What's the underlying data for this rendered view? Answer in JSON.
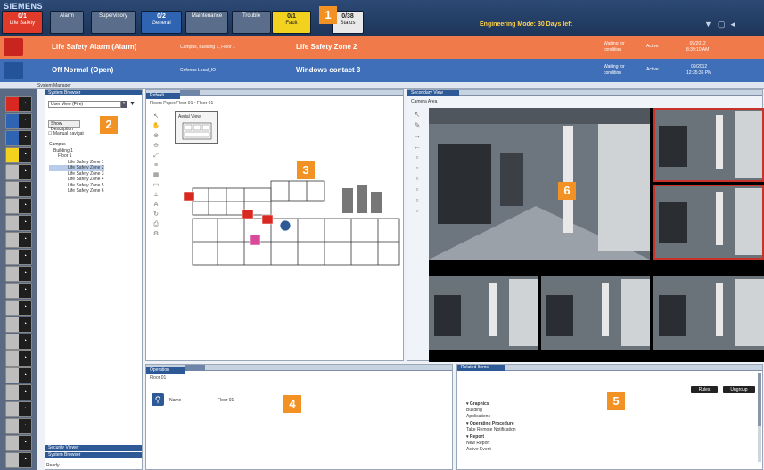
{
  "header": {
    "brand": "SIEMENS",
    "categories": [
      {
        "count": "0/1",
        "label": "Life Safety",
        "color": "#e03b2a"
      },
      {
        "count": "",
        "label": "Alarm",
        "color": "#5a6d8a"
      },
      {
        "count": "",
        "label": "Supervisory",
        "color": "#5a6d8a"
      },
      {
        "count": "0/2",
        "label": "General",
        "color": "#2f64b3"
      },
      {
        "count": "",
        "label": "Maintenance",
        "color": "#5a6d8a"
      },
      {
        "count": "",
        "label": "Trouble",
        "color": "#5a6d8a"
      },
      {
        "count": "0/1",
        "label": "Fault",
        "color": "#f2d21e"
      },
      {
        "count": "0/38",
        "label": "Status",
        "color": "#e9e9e9"
      }
    ],
    "engineering_mode": "Engineering Mode: 30 Days left"
  },
  "alarms": [
    {
      "title": "Life Safety Alarm (Alarm)",
      "location": "Campus, Building 1, Floor 1",
      "name": "Life Safety Zone 2",
      "condition": "Waiting for condition",
      "state": "Active",
      "date": "09/2012",
      "time": "8:39:10 AM"
    },
    {
      "title": "Off Normal (Open)",
      "location": "Cnfenus Local_IO",
      "name": "Windows contact 3",
      "condition": "Waiting for condition",
      "state": "Active",
      "date": "09/2012",
      "time": "12:35:36 PM"
    }
  ],
  "system_manager": {
    "title": "System Manager"
  },
  "browser": {
    "header": "System Browser",
    "view_selector": "User View (Fire)",
    "show_description": "Show Description",
    "manual_navigation": "Manual navigat",
    "tree": [
      {
        "label": "Campus",
        "level": 0
      },
      {
        "label": "Building 1",
        "level": 1
      },
      {
        "label": "Floor 1",
        "level": 2
      },
      {
        "label": "Life Safety Zone 1",
        "level": 3
      },
      {
        "label": "Life Safety Zone 2",
        "level": 3
      },
      {
        "label": "Life Safety Zone 3",
        "level": 3
      },
      {
        "label": "Life Safety Zone 4",
        "level": 3
      },
      {
        "label": "Life Safety Zone 5",
        "level": 3
      },
      {
        "label": "Life Safety Zone 6",
        "level": 3
      }
    ],
    "selected_index": 4,
    "bottom_tabs": [
      "Security Viewer",
      "System Browser"
    ],
    "status": "Ready"
  },
  "graphic": {
    "tabs": [
      "Default"
    ],
    "breadcrumb": "Floors Paper/Floor 01 • Floor 01",
    "aerial_view_label": "Aerial View"
  },
  "secondary": {
    "tab": "Secondary View",
    "camera_area": "Camera Area"
  },
  "operation": {
    "tab": "Operation",
    "subtitle": "Floor 01",
    "name_label": "Name",
    "name_value": "Floor 01"
  },
  "related": {
    "tab": "Related Items",
    "buttons": [
      "Rules",
      "Ungroup"
    ],
    "items": [
      {
        "text": "Graphics",
        "heading": true
      },
      {
        "text": "Building",
        "heading": false
      },
      {
        "text": "Applications",
        "heading": false
      },
      {
        "text": "Operating Procedure",
        "heading": true
      },
      {
        "text": "Take Remote Notification",
        "heading": false
      },
      {
        "text": "Report",
        "heading": true
      },
      {
        "text": "New Report",
        "heading": false
      },
      {
        "text": "Active Event",
        "heading": false
      }
    ]
  },
  "callouts": [
    "1",
    "2",
    "3",
    "4",
    "5",
    "6"
  ]
}
